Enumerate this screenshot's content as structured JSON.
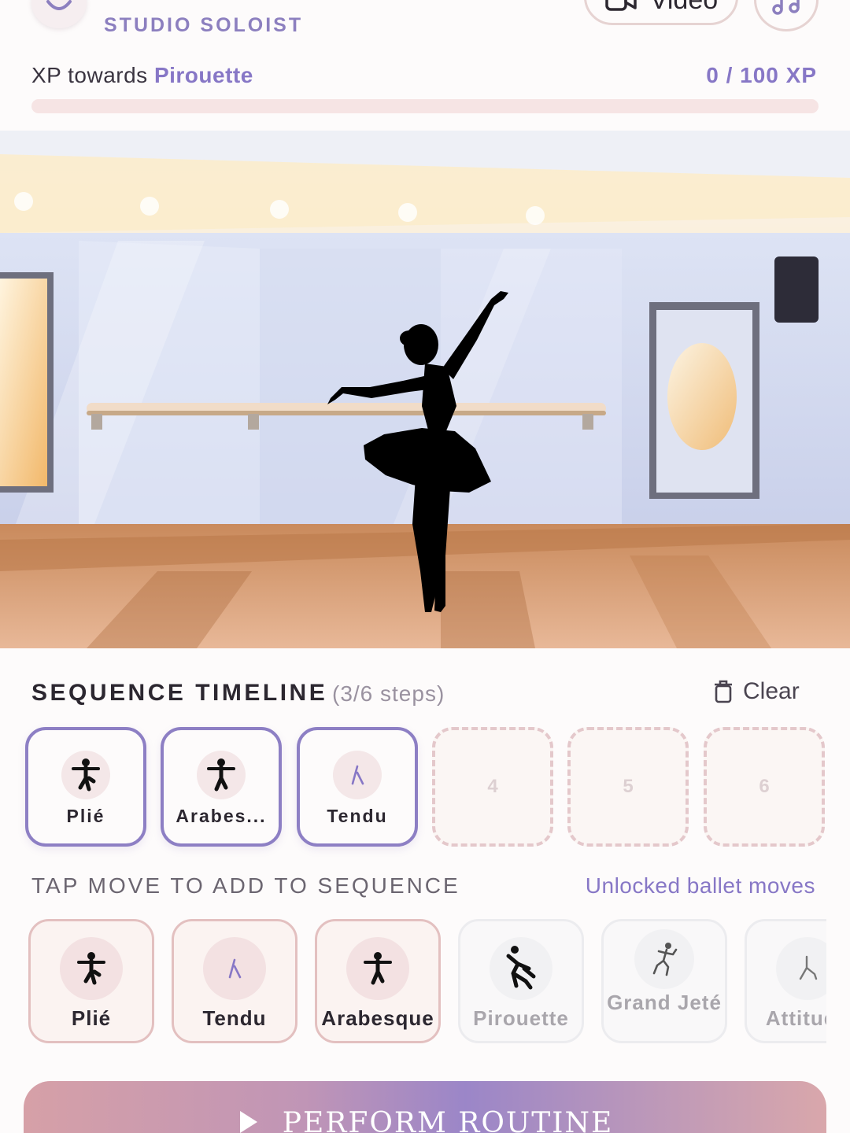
{
  "header": {
    "avatar_icon": "smiley-face-icon",
    "rank": "STUDIO SOLOIST",
    "video_button": {
      "label": "Video",
      "icon": "video-camera-icon"
    },
    "music_button": {
      "icon": "music-note-icon"
    }
  },
  "xp": {
    "prefix": "XP towards",
    "target_move": "Pirouette",
    "count_label": "0 / 100 XP",
    "progress": 0
  },
  "stage": {
    "scene": "ballet-studio",
    "figure_icon": "ballerina-silhouette-icon"
  },
  "timeline": {
    "title": "SEQUENCE TIMELINE",
    "steps_label": "(3/6 steps)",
    "clear_label": "Clear",
    "clear_icon": "trash-icon",
    "slots": [
      {
        "filled": true,
        "name": "Plié",
        "icon": "plie-figure-icon"
      },
      {
        "filled": true,
        "name": "Arabes...",
        "icon": "arabesque-figure-icon"
      },
      {
        "filled": true,
        "name": "Tendu",
        "icon": "tendu-figure-icon"
      },
      {
        "filled": false,
        "number": "4"
      },
      {
        "filled": false,
        "number": "5"
      },
      {
        "filled": false,
        "number": "6"
      }
    ]
  },
  "palette": {
    "title": "TAP MOVE TO ADD TO SEQUENCE",
    "subtitle": "Unlocked ballet moves",
    "moves": [
      {
        "name": "Plié",
        "icon": "plie-figure-icon",
        "locked": false
      },
      {
        "name": "Tendu",
        "icon": "tendu-figure-icon",
        "locked": false
      },
      {
        "name": "Arabesque",
        "icon": "arabesque-figure-icon",
        "locked": false
      },
      {
        "name": "Pirouette",
        "icon": "pirouette-figure-icon",
        "locked": true
      },
      {
        "name": "Grand Jeté",
        "icon": "grand-jete-figure-icon",
        "locked": true
      },
      {
        "name": "Attitude",
        "icon": "attitude-figure-icon",
        "locked": true
      }
    ]
  },
  "perform": {
    "label": "PERFORM ROUTINE",
    "icon": "play-icon"
  },
  "colors": {
    "accent": "#8777c6",
    "slot_border": "#8d7fc4",
    "unlocked_border": "#e3c0c0",
    "locked_text": "#a9a6ac"
  }
}
